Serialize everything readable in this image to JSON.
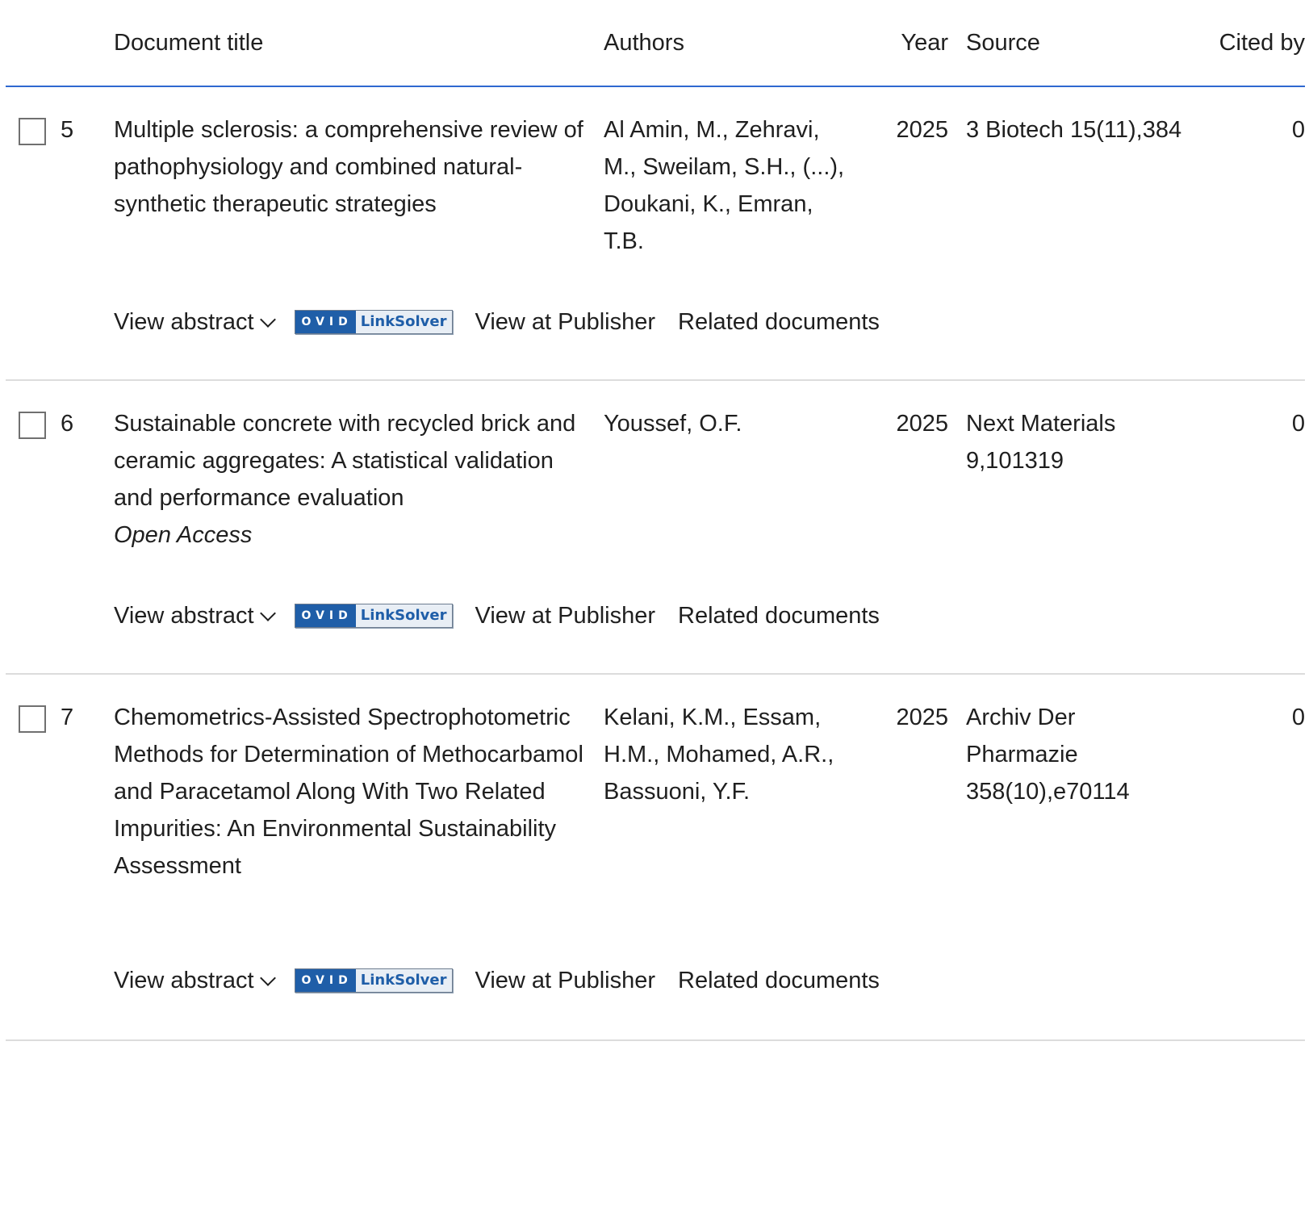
{
  "columns": {
    "title": "Document title",
    "authors": "Authors",
    "year": "Year",
    "source": "Source",
    "cited_by": "Cited by"
  },
  "actions": {
    "view_abstract": "View abstract",
    "ovid_left": "OVID",
    "ovid_right": "LinkSolver",
    "view_publisher": "View at Publisher",
    "related": "Related documents"
  },
  "results": [
    {
      "index": "5",
      "title": "Multiple sclerosis: a comprehensive review of pathophysiology and combined natural-synthetic therapeutic strategies",
      "open_access": "",
      "authors": "Al Amin, M., Zehravi, M., Sweilam, S.H., (...), Doukani, K., Emran, T.B.",
      "year": "2025",
      "source": "3 Biotech 15(11),384",
      "cited_by": "0"
    },
    {
      "index": "6",
      "title": "Sustainable concrete with recycled brick and ceramic aggregates: A statistical validation and performance evaluation",
      "open_access": "Open Access",
      "authors": "Youssef, O.F.",
      "year": "2025",
      "source": "Next Materials 9,101319",
      "cited_by": "0"
    },
    {
      "index": "7",
      "title": "Chemometrics-Assisted Spectrophotometric Methods for Determination of Methocarbamol and Paracetamol Along With Two Related Impurities: An Environmental Sustainability Assessment",
      "open_access": "",
      "authors": "Kelani, K.M., Essam, H.M., Mohamed, A.R., Bassuoni, Y.F.",
      "year": "2025",
      "source": "Archiv Der Pharmazie 358(10),e70114",
      "cited_by": "0"
    }
  ],
  "colors": {
    "header_rule": "#2e68d0",
    "row_rule": "#dcdcdc",
    "ovid_blue": "#1f5ea8"
  }
}
